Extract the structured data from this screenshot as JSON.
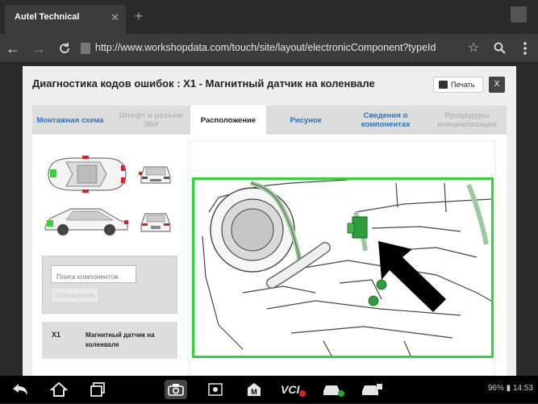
{
  "browser": {
    "tab_title": "Autel Technical",
    "tab_close": "✕",
    "new_tab": "+",
    "url": "http://www.workshopdata.com/touch/site/layout/electronicComponent?typeId"
  },
  "dialog": {
    "title": "Диагностика кодов ошибок : X1 - Магнитный датчик на коленвале",
    "print_label": "Печать",
    "close_label": "X",
    "tabs": [
      {
        "label": "Монтажная схема",
        "state": "link"
      },
      {
        "label": "Штифт и разъем ЭБУ",
        "state": "disabled"
      },
      {
        "label": "Расположение",
        "state": "active"
      },
      {
        "label": "Рисунок",
        "state": "link"
      },
      {
        "label": "Сведения о компонентах",
        "state": "link"
      },
      {
        "label": "Процедуры инициализации",
        "state": "disabled"
      }
    ],
    "search": {
      "placeholder": "Поиск компонентов",
      "button": "Обновление"
    },
    "components": [
      {
        "code": "X1",
        "name": "Магнитный датчик на коленвале"
      }
    ]
  },
  "colors": {
    "highlight": "#33d433",
    "component_green": "#2e9e3a",
    "link_blue": "#2673c4",
    "thumb_red": "#d8232a"
  },
  "statusbar": {
    "battery": "96%",
    "time": "14:53"
  }
}
